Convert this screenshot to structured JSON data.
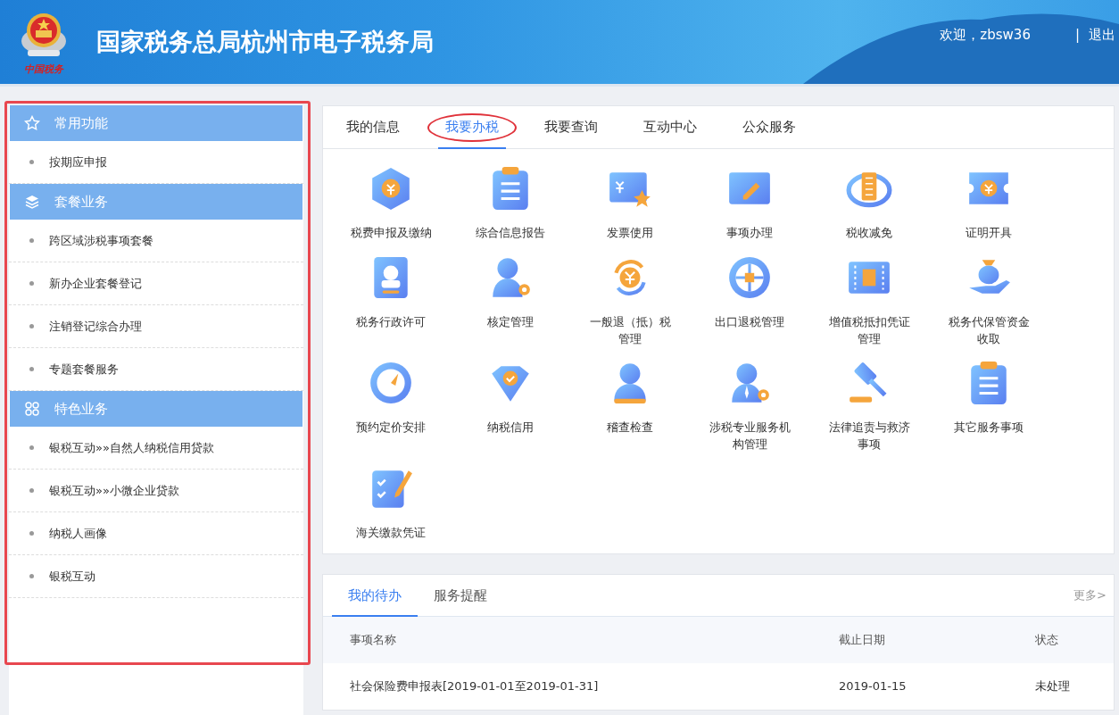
{
  "header": {
    "logo_caption": "中国税务",
    "title": "国家税务总局杭州市电子税务局",
    "welcome": "欢迎，zbsw36",
    "separator": "|",
    "logout": "退出"
  },
  "sidebar": {
    "highlighted": true,
    "sections": [
      {
        "title": "常用功能",
        "kind": "star",
        "items": [
          "按期应申报"
        ]
      },
      {
        "title": "套餐业务",
        "kind": "layers",
        "items": [
          "跨区域涉税事项套餐",
          "新办企业套餐登记",
          "注销登记综合办理",
          "专题套餐服务"
        ]
      },
      {
        "title": "特色业务",
        "kind": "grid",
        "items": [
          "银税互动»»自然人纳税信用贷款",
          "银税互动»»小微企业贷款",
          "纳税人画像",
          "银税互动"
        ]
      }
    ]
  },
  "main_tabs": [
    {
      "label": "我的信息",
      "selected": false,
      "circled": false
    },
    {
      "label": "我要办税",
      "selected": true,
      "circled": true
    },
    {
      "label": "我要查询",
      "selected": false,
      "circled": false
    },
    {
      "label": "互动中心",
      "selected": false,
      "circled": false
    },
    {
      "label": "公众服务",
      "selected": false,
      "circled": false
    }
  ],
  "services": [
    [
      "税费申报及缴纳"
    ],
    [
      "综合信息报告"
    ],
    [
      "发票使用"
    ],
    [
      "事项办理"
    ],
    [
      "税收减免"
    ],
    [
      "证明开具"
    ],
    [
      "税务行政许可"
    ],
    [
      "核定管理"
    ],
    [
      "一般退（抵）税",
      "管理"
    ],
    [
      "出口退税管理"
    ],
    [
      "增值税抵扣凭证",
      "管理"
    ],
    [
      "税务代保管资金",
      "收取"
    ],
    [
      "预约定价安排"
    ],
    [
      "纳税信用"
    ],
    [
      "稽查检查"
    ],
    [
      "涉税专业服务机",
      "构管理"
    ],
    [
      "法律追责与救济",
      "事项"
    ],
    [
      "其它服务事项"
    ],
    [
      "海关缴款凭证"
    ]
  ],
  "todo": {
    "tabs": [
      {
        "label": "我的待办",
        "selected": true
      },
      {
        "label": "服务提醒",
        "selected": false
      }
    ],
    "more": "更多>",
    "columns": [
      "事项名称",
      "截止日期",
      "状态"
    ],
    "rows": [
      [
        "社会保险费申报表[2019-01-01至2019-01-31]",
        "2019-01-15",
        "未处理"
      ]
    ]
  }
}
